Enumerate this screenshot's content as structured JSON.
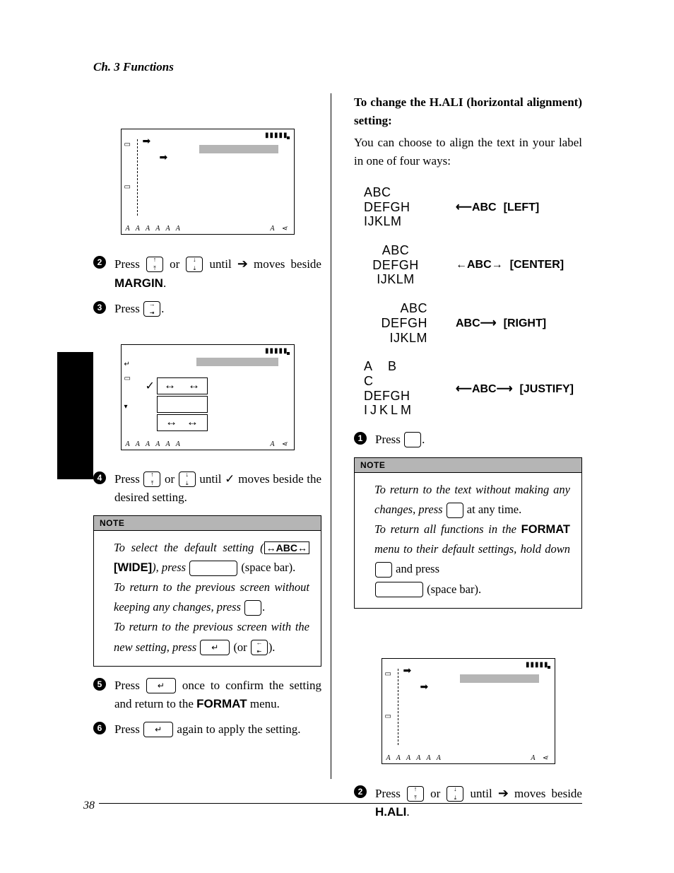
{
  "header": "Ch. 3 Functions",
  "pageNumber": "38",
  "left": {
    "step2": {
      "pre": "Press ",
      "or": " or ",
      "tail": " until ",
      "arrow": "➔",
      "post": " moves beside ",
      "target": "MARGIN",
      "dot": "."
    },
    "step3": {
      "pre": "Press ",
      "tail": "."
    },
    "step4": {
      "pre": "Press ",
      "or": " or ",
      "mid": " until ",
      "check": "✓",
      "post": " moves beside the desired setting."
    },
    "note": {
      "l1a": "To select the default setting (",
      "l1sym": "↔ABC↔",
      "l1b": "[WIDE]",
      "l1c": "), press ",
      "l1d": " (space bar).",
      "l2a": "To return to the previous screen without keeping any changes, press ",
      "l2b": ".",
      "l3a": "To return to the previous screen with the new setting, press ",
      "l3b": " (or ",
      "l3c": ")."
    },
    "step5": {
      "pre": "Press ",
      "mid": " once to confirm the setting and return to the ",
      "menu": "FORMAT",
      "post": " menu."
    },
    "step6": {
      "pre": "Press ",
      "post": " again to apply the setting."
    }
  },
  "right": {
    "heading": "To change the H.ALI (horizontal alignment) setting:",
    "intro": "You can choose to align the text in your label in one of four ways:",
    "rows": {
      "left": {
        "l1": "ABC",
        "l2": "DEFGH",
        "l3": "IJKLM",
        "sym": "⟵ABC",
        "name": "[LEFT]"
      },
      "center": {
        "l1": "ABC",
        "l2": "DEFGH",
        "l3": "IJKLM",
        "sym": "←ABC→",
        "name": "[CENTER]"
      },
      "rightr": {
        "l1": "ABC",
        "l2": "DEFGH",
        "l3": "IJKLM",
        "sym": "ABC⟶",
        "name": "[RIGHT]"
      },
      "justify": {
        "l1": "A B C",
        "l2": "DEFGH",
        "l3": "IJKLM",
        "sym": "⟵ABC⟶",
        "name": "[JUSTIFY]"
      }
    },
    "step1": {
      "pre": "Press ",
      "post": "."
    },
    "note": {
      "l1a": "To return to the text without making any changes, press ",
      "l1b": " at any time.",
      "l2a": "To return all functions in the ",
      "l2b": "FORMAT",
      "l2c": " menu to their default settings, hold down ",
      "l2d": " and press ",
      "l2e": " (space bar)."
    },
    "step2": {
      "pre": "Press ",
      "or": " or ",
      "mid": " until ",
      "arrow": "➔",
      "post": " moves beside ",
      "target": "H.ALI",
      "dot": "."
    }
  },
  "noteLabel": "NOTE",
  "lcdBottom": "A A A A A A"
}
